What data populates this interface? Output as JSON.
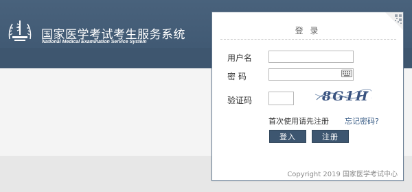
{
  "header": {
    "title": "国家医学考试考生服务系统",
    "subtitle": "National Medical Examination Service System",
    "logo_icon": "medical-emblem-logo"
  },
  "login": {
    "title": "登 录",
    "username_label": "用户名",
    "username_value": "",
    "password_label": "密 码",
    "password_value": "",
    "captcha_label": "验证码",
    "captcha_value": "",
    "captcha_text": "8G1H",
    "first_use_link": "首次使用请先注册",
    "forgot_link": "忘记密码?",
    "login_button": "登入",
    "register_button": "注册",
    "copyright": "Copyright 2019 国家医学考试中心",
    "corner_icon": "qr-code-icon",
    "keyboard_icon": "keyboard-icon"
  },
  "colors": {
    "header": "#445d77",
    "button": "#3d5670",
    "link": "#3a5d86",
    "page_background": "#f3f3f3",
    "band": "#e7e7e7"
  }
}
